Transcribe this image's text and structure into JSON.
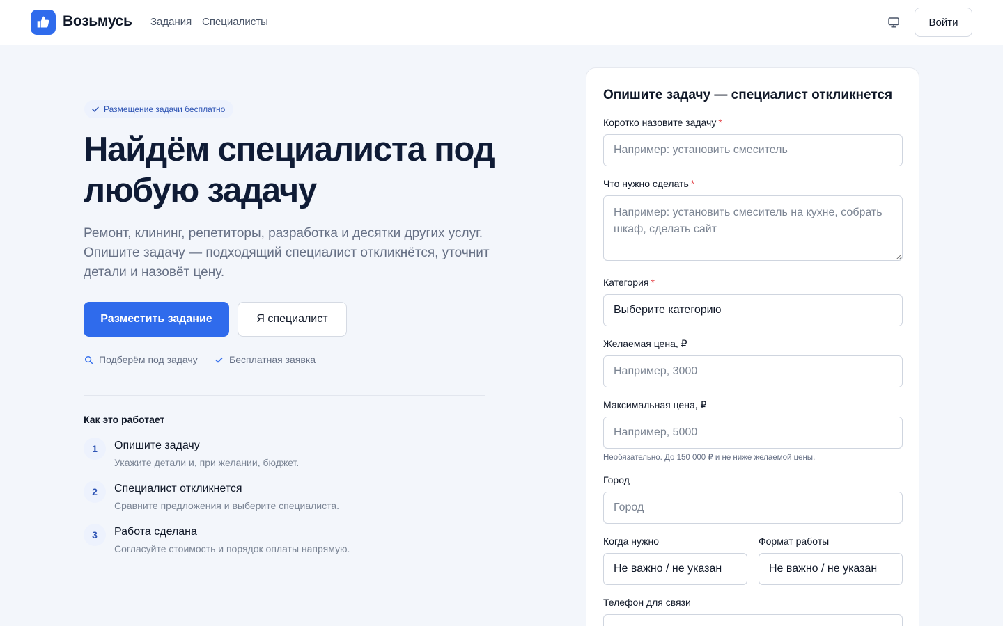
{
  "header": {
    "brand": "Возьмусь",
    "nav": [
      "Задания",
      "Специалисты"
    ],
    "login_label": "Войти"
  },
  "hero": {
    "badge": "Размещение задачи бесплатно",
    "title": "Найдём специалиста под любую задачу",
    "subtitle": "Ремонт, клининг, репетиторы, разработка и десятки других услуг. Опишите задачу — подходящий специалист откликнётся, уточнит детали и назовёт цену.",
    "primary_button": "Разместить задание",
    "secondary_button": "Я специалист",
    "features": [
      "Подберём под задачу",
      "Бесплатная заявка"
    ]
  },
  "how": {
    "title": "Как это работает",
    "steps": [
      {
        "num": "1",
        "title": "Опишите задачу",
        "desc": "Укажите детали и, при желании, бюджет."
      },
      {
        "num": "2",
        "title": "Специалист откликнется",
        "desc": "Сравните предложения и выберите специалиста."
      },
      {
        "num": "3",
        "title": "Работа сделана",
        "desc": "Согласуйте стоимость и порядок оплаты напрямую."
      }
    ]
  },
  "form": {
    "title": "Опишите задачу — специалист откликнется",
    "task_label": "Коротко назовите задачу",
    "task_placeholder": "Например: установить смеситель",
    "details_label": "Что нужно сделать",
    "details_placeholder": "Например: установить смеситель на кухне, собрать шкаф, сделать сайт",
    "category_label": "Категория",
    "category_value": "Выберите категорию",
    "price_label": "Желаемая цена, ₽",
    "price_placeholder": "Например, 3000",
    "max_price_label": "Максимальная цена, ₽",
    "max_price_placeholder": "Например, 5000",
    "max_price_hint": "Необязательно. До 150 000 ₽ и не ниже желаемой цены.",
    "city_label": "Город",
    "city_placeholder": "Город",
    "when_label": "Когда нужно",
    "when_value": "Не важно / не указан",
    "format_label": "Формат работы",
    "format_value": "Не важно / не указан",
    "phone_label": "Телефон для связи",
    "required_mark": "*"
  },
  "colors": {
    "accent": "#2f6bec",
    "background": "#f3f6fb",
    "required": "#e5484d"
  }
}
